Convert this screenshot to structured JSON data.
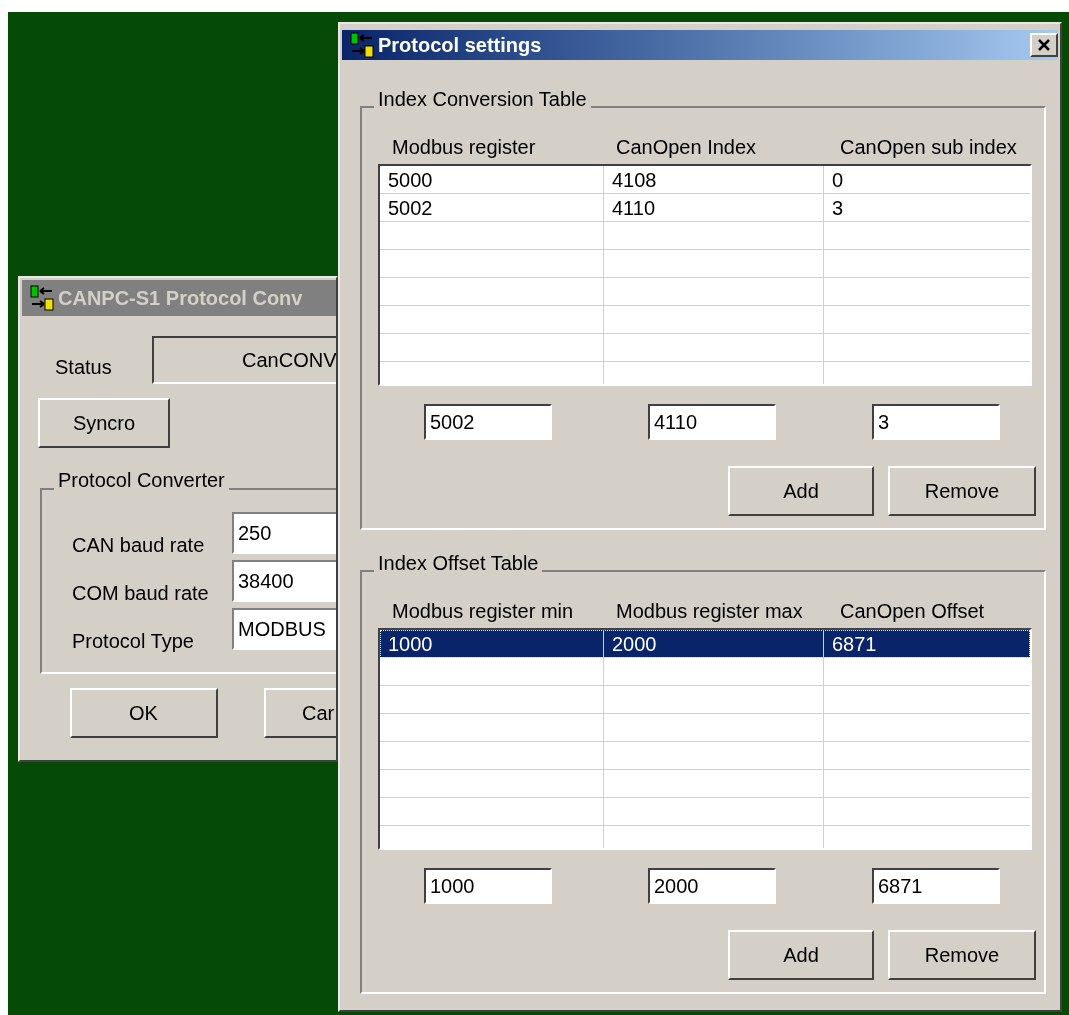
{
  "main_window": {
    "title": "CANPC-S1 Protocol Conv",
    "status_label": "Status",
    "status_value": "CanCONV",
    "syncro_button": "Syncro",
    "group": {
      "title": "Protocol Converter",
      "fields": [
        {
          "label": "CAN baud rate",
          "value": "250"
        },
        {
          "label": "COM baud rate",
          "value": "38400"
        },
        {
          "label": "Protocol Type",
          "value": "MODBUS"
        }
      ]
    },
    "buttons": [
      "OK",
      "Car"
    ]
  },
  "settings_window": {
    "title": "Protocol settings",
    "sections": [
      {
        "title": "Index Conversion Table",
        "columns": [
          "Modbus register",
          "CanOpen Index",
          "CanOpen sub index"
        ],
        "rows": [
          {
            "cells": [
              "5000",
              "4108",
              "0"
            ],
            "selected": false
          },
          {
            "cells": [
              "5002",
              "4110",
              "3"
            ],
            "selected": false
          }
        ],
        "inputs": [
          "5002",
          "4110",
          "3"
        ],
        "buttons": [
          "Add",
          "Remove"
        ]
      },
      {
        "title": "Index Offset Table",
        "columns": [
          "Modbus register min",
          "Modbus register max",
          "CanOpen Offset"
        ],
        "rows": [
          {
            "cells": [
              "1000",
              "2000",
              "6871"
            ],
            "selected": true
          }
        ],
        "inputs": [
          "1000",
          "2000",
          "6871"
        ],
        "buttons": [
          "Add",
          "Remove"
        ]
      }
    ]
  }
}
